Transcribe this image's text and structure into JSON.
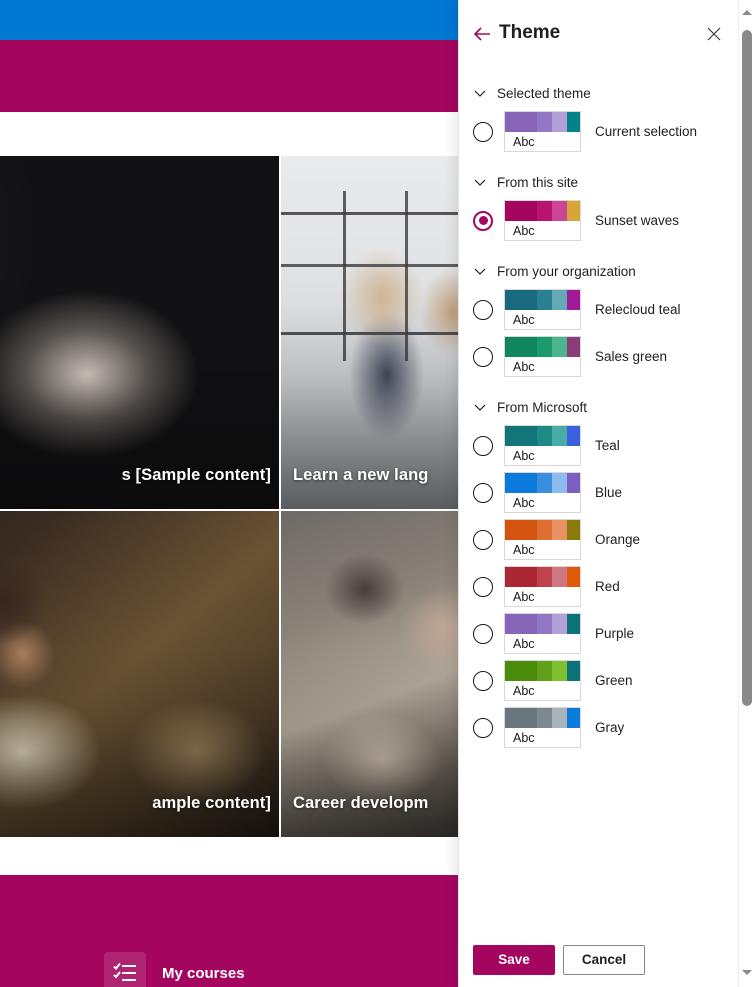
{
  "background": {
    "topbar_color": "#0078d4",
    "site_header_color": "#a4065f",
    "cards": [
      {
        "caption": "s [Sample content]",
        "align": "right"
      },
      {
        "caption": "Learn a new lang",
        "align": "left"
      },
      {
        "caption": "ample content]",
        "align": "right"
      },
      {
        "caption": "Career developm",
        "align": "left"
      }
    ],
    "my_courses": {
      "label": "My courses",
      "icon": "checklist-icon"
    }
  },
  "panel": {
    "title": "Theme",
    "back_icon": "back-arrow-icon",
    "close_icon": "close-icon",
    "accent_color": "#a4065f",
    "sections": [
      {
        "label": "Selected theme",
        "chevron": "chevron-down-icon",
        "themes": [
          {
            "name": "Current selection",
            "selected": false,
            "sample_text": "Abc",
            "colors": [
              "#8764b8",
              "#9277c4",
              "#b4a0d8",
              "#038387"
            ]
          }
        ]
      },
      {
        "label": "From this site",
        "chevron": "chevron-down-icon",
        "themes": [
          {
            "name": "Sunset waves",
            "selected": true,
            "sample_text": "Abc",
            "colors": [
              "#a4065f",
              "#b81472",
              "#cc4596",
              "#d9a43a"
            ]
          }
        ]
      },
      {
        "label": "From your organization",
        "chevron": "chevron-down-icon",
        "themes": [
          {
            "name": "Relecloud teal",
            "selected": false,
            "sample_text": "Abc",
            "colors": [
              "#19697f",
              "#2a7f94",
              "#63aab5",
              "#a3199b"
            ]
          },
          {
            "name": "Sales green",
            "selected": false,
            "sample_text": "Abc",
            "colors": [
              "#11875f",
              "#1e9b6e",
              "#4bb58e",
              "#8a3b78"
            ]
          }
        ]
      },
      {
        "label": "From Microsoft",
        "chevron": "chevron-down-icon",
        "themes": [
          {
            "name": "Teal",
            "selected": false,
            "sample_text": "Abc",
            "colors": [
              "#11757a",
              "#1d8a86",
              "#47ada5",
              "#3a60e0"
            ]
          },
          {
            "name": "Blue",
            "selected": false,
            "sample_text": "Abc",
            "colors": [
              "#0a7bdd",
              "#3a8ede",
              "#8cbced",
              "#7a5fc0"
            ]
          },
          {
            "name": "Orange",
            "selected": false,
            "sample_text": "Abc",
            "colors": [
              "#d4540f",
              "#de6f32",
              "#e79164",
              "#8a7a0c"
            ]
          },
          {
            "name": "Red",
            "selected": false,
            "sample_text": "Abc",
            "colors": [
              "#ab2733",
              "#bf434c",
              "#cf7780",
              "#de5908"
            ]
          },
          {
            "name": "Purple",
            "selected": false,
            "sample_text": "Abc",
            "colors": [
              "#8764b8",
              "#9277c4",
              "#b4a0d8",
              "#0a7278"
            ]
          },
          {
            "name": "Green",
            "selected": false,
            "sample_text": "Abc",
            "colors": [
              "#4a8c0a",
              "#62a01c",
              "#7fc02f",
              "#0a7278"
            ]
          },
          {
            "name": "Gray",
            "selected": false,
            "sample_text": "Abc",
            "colors": [
              "#69767e",
              "#7c8891",
              "#a9b3ba",
              "#0a7bdd"
            ]
          }
        ]
      }
    ],
    "footer": {
      "save_label": "Save",
      "cancel_label": "Cancel"
    },
    "scrollbar": {
      "up_icon": "scroll-up-arrow-icon",
      "down_icon": "scroll-down-arrow-icon"
    }
  }
}
